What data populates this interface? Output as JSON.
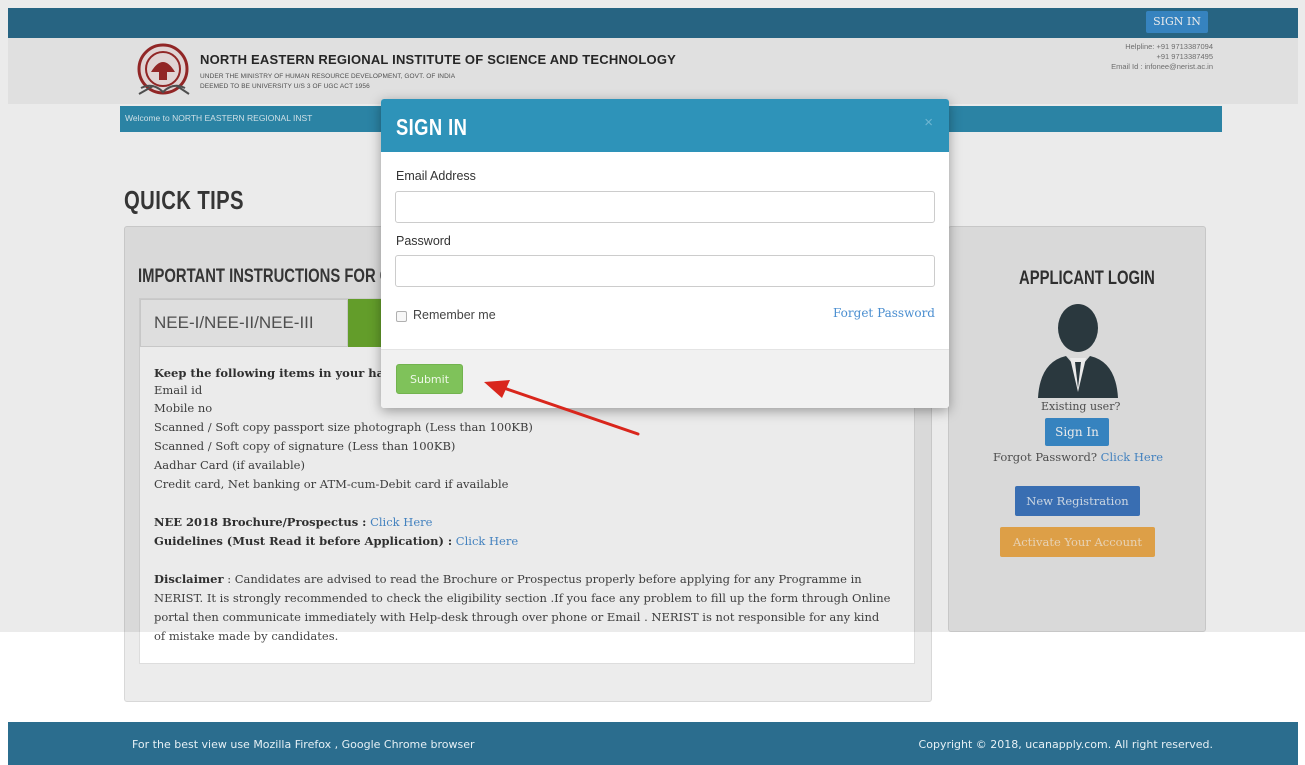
{
  "topbar": {
    "signin_label": "SIGN IN",
    "color": "#2b6d8e"
  },
  "header": {
    "institute_name": "NORTH EASTERN REGIONAL INSTITUTE OF SCIENCE AND TECHNOLOGY",
    "subtitle_1": "UNDER THE MINISTRY OF HUMAN RESOURCE DEVELOPMENT, GOVT. OF INDIA",
    "subtitle_2": "DEEMED TO BE UNIVERSITY U/S 3 OF UGC ACT 1956",
    "helpline_1": "Helpline: +91 9713387094",
    "helpline_2": "+91 9713387495",
    "email_line": "Email Id : infonee@nerist.ac.in"
  },
  "welcome": {
    "text": "Welcome to NORTH EASTERN REGIONAL INST"
  },
  "quick_tips": {
    "title": "QUICK TIPS"
  },
  "instructions": {
    "heading": "IMPORTANT INSTRUCTIONS FOR CAN",
    "tab_label": "NEE-I/NEE-II/NEE-III",
    "keep_heading": "Keep the following items in your han",
    "items": [
      "Email id",
      "Mobile no",
      "Scanned / Soft copy passport size photograph (Less than 100KB)",
      "Scanned / Soft copy of signature (Less than 100KB)",
      "Aadhar Card (if available)",
      "Credit card, Net banking or ATM-cum-Debit card if available"
    ],
    "brochure_label": "NEE 2018 Brochure/Prospectus :",
    "brochure_link": "Click Here",
    "guidelines_label": "Guidelines (Must Read it before Application) :",
    "guidelines_link": "Click Here",
    "disclaimer_label": "Disclaimer",
    "disclaimer_lines": [
      " : Candidates are advised to read the Brochure or Prospectus properly before applying for any Programme in",
      "NERIST. It is strongly recommended to check the eligibility section .If you face any problem to fill up the form through Online",
      "portal then communicate immediately with Help-desk through over phone or Email . NERIST is not responsible for any kind",
      "of mistake made by candidates."
    ]
  },
  "applicant": {
    "heading": "APPLICANT LOGIN",
    "existing_user": "Existing user?",
    "signin_label": "Sign In",
    "forgot_text": "Forgot Password?",
    "forgot_link": "Click Here",
    "new_registration": "New Registration",
    "activate_account": "Activate Your Account"
  },
  "modal": {
    "title": "SIGN IN",
    "close": "×",
    "email_label": "Email Address",
    "email_value": "",
    "password_label": "Password",
    "password_value": "",
    "remember_label": "Remember me",
    "forget_password": "Forget Password",
    "submit_label": "Submit",
    "header_color": "#2e93b9",
    "submit_color": "#7fc25a"
  },
  "footer": {
    "left_text": "For the best view use Mozilla Firefox , Google Chrome browser",
    "right_text": "Copyright © 2018, ucanapply.com. All right reserved."
  }
}
